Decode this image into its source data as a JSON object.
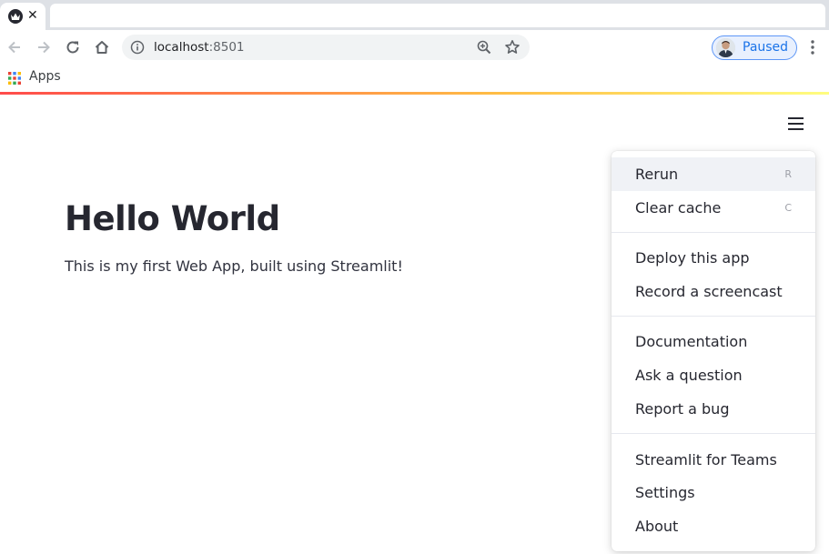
{
  "browser": {
    "tab": {
      "close_glyph": "✕"
    },
    "address_bar": {
      "host": "localhost",
      "port": ":8501"
    },
    "profile": {
      "status": "Paused"
    },
    "bookmarks": {
      "apps_label": "Apps"
    }
  },
  "app": {
    "title": "Hello World",
    "subtitle": "This is my first Web App, built using Streamlit!"
  },
  "main_menu": {
    "groups": [
      [
        {
          "label": "Rerun",
          "shortcut": "R",
          "highlighted": true
        },
        {
          "label": "Clear cache",
          "shortcut": "C"
        }
      ],
      [
        {
          "label": "Deploy this app"
        },
        {
          "label": "Record a screencast"
        }
      ],
      [
        {
          "label": "Documentation"
        },
        {
          "label": "Ask a question"
        },
        {
          "label": "Report a bug"
        }
      ],
      [
        {
          "label": "Streamlit for Teams"
        },
        {
          "label": "Settings"
        },
        {
          "label": "About"
        }
      ]
    ]
  },
  "colors": {
    "accent_gradient": [
      "#ff4b4b",
      "#ffbd45",
      "#fffd80"
    ],
    "text_primary": "#262730",
    "profile_accent": "#1a73e8"
  },
  "icons": [
    "streamlit-favicon",
    "close-icon",
    "back-arrow-icon",
    "forward-arrow-icon",
    "reload-icon",
    "home-icon",
    "info-icon",
    "zoom-icon",
    "star-icon",
    "avatar",
    "kebab-menu-icon",
    "apps-grid-icon",
    "hamburger-menu-icon"
  ]
}
